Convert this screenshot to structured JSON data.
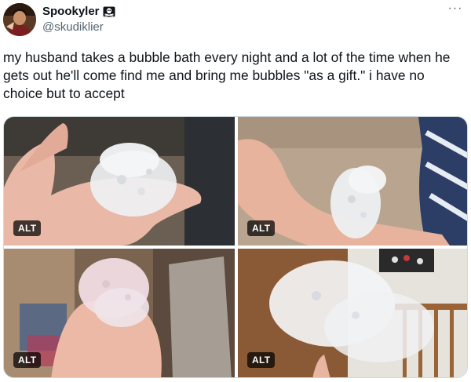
{
  "author": {
    "display_name": "Spookyler",
    "handle": "@skudiklier",
    "badge_icon": "skull-crossbones-icon"
  },
  "menu": {
    "more_label": "···"
  },
  "tweet": {
    "text": "my husband takes a bubble bath every night and a lot of the time when he gets out he'll come find me and bring me bubbles \"as a gift.\" i have no choice but to accept"
  },
  "media": {
    "alt_labels": [
      "ALT",
      "ALT",
      "ALT",
      "ALT"
    ]
  },
  "colors": {
    "text_primary": "#0f1419",
    "text_secondary": "#536471",
    "border": "#cfd9de",
    "alt_badge_bg": "#000000"
  }
}
